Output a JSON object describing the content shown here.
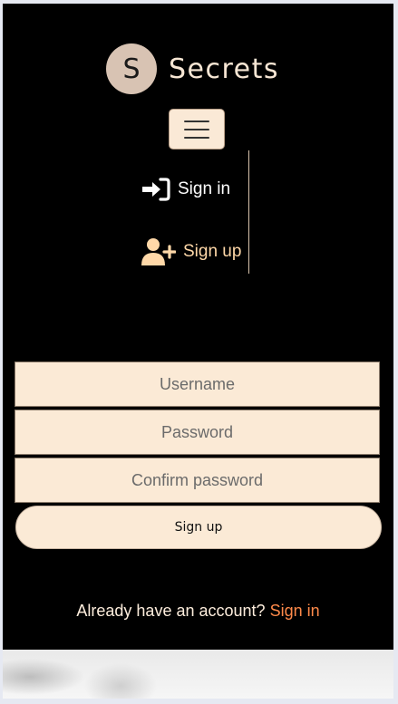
{
  "brand": {
    "logo_letter": "S",
    "name": "Secrets"
  },
  "nav": {
    "menu_icon": "hamburger-icon",
    "signin": {
      "label": "Sign in",
      "icon": "sign-in-icon"
    },
    "signup": {
      "label": "Sign up",
      "icon": "user-plus-icon"
    }
  },
  "form": {
    "username_placeholder": "Username",
    "password_placeholder": "Password",
    "confirm_placeholder": "Confirm password",
    "submit_label": "Sign up"
  },
  "footer": {
    "already_text": "Already have an account?",
    "signin_link": "Sign in"
  },
  "colors": {
    "background": "#000000",
    "field_bg": "#fbead6",
    "link_accent": "#ff8a4a",
    "signup_accent": "#ffd8a8"
  }
}
